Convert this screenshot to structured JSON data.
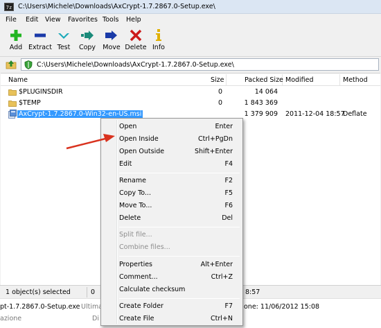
{
  "window": {
    "title": "C:\\Users\\Michele\\Downloads\\AxCrypt-1.7.2867.0-Setup.exe\\",
    "app_icon_text": "7z"
  },
  "menu": [
    "File",
    "Edit",
    "View",
    "Favorites",
    "Tools",
    "Help"
  ],
  "toolbar": [
    {
      "label": "Add",
      "icon": "plus-icon",
      "color": "#22b522"
    },
    {
      "label": "Extract",
      "icon": "minus-icon",
      "color": "#1a3aa8"
    },
    {
      "label": "Test",
      "icon": "checkmark-icon",
      "color": "#1aa9b8"
    },
    {
      "label": "Copy",
      "icon": "copy-arrow-icon",
      "color": "#1a8a7a"
    },
    {
      "label": "Move",
      "icon": "move-arrow-icon",
      "color": "#1a3aa8"
    },
    {
      "label": "Delete",
      "icon": "delete-x-icon",
      "color": "#cc1a1a"
    },
    {
      "label": "Info",
      "icon": "info-icon",
      "color": "#e0b000"
    }
  ],
  "address": {
    "path": "C:\\Users\\Michele\\Downloads\\AxCrypt-1.7.2867.0-Setup.exe\\"
  },
  "columns": [
    "Name",
    "Size",
    "Packed Size",
    "Modified",
    "Method"
  ],
  "files": [
    {
      "name": "$PLUGINSDIR",
      "size": "0",
      "packed": "14 064",
      "modified": "",
      "method": "",
      "type": "folder",
      "selected": false
    },
    {
      "name": "$TEMP",
      "size": "0",
      "packed": "1 843 369",
      "modified": "",
      "method": "",
      "type": "folder",
      "selected": false
    },
    {
      "name": "AxCrypt-1.7.2867.0-Win32-en-US.msi",
      "size": "",
      "packed": "1 379 909",
      "modified": "2011-12-04 18:57",
      "method": "Deflate",
      "type": "msi",
      "selected": true
    }
  ],
  "status": {
    "selected": "1 object(s) selected",
    "size": "0",
    "time_fragment": "8:57"
  },
  "below": {
    "filename_fragment": "pt-1.7.2867.0-Setup.exe",
    "ultima_fragment": "Ultima",
    "azione_fragment": "azione",
    "di_fragment": "Di",
    "date_fragment": "one: 11/06/2012 15:08"
  },
  "context_menu": {
    "groups": [
      [
        {
          "label": "Open",
          "shortcut": "Enter",
          "enabled": true
        },
        {
          "label": "Open Inside",
          "shortcut": "Ctrl+PgDn",
          "enabled": true
        },
        {
          "label": "Open Outside",
          "shortcut": "Shift+Enter",
          "enabled": true
        },
        {
          "label": "Edit",
          "shortcut": "F4",
          "enabled": true
        }
      ],
      [
        {
          "label": "Rename",
          "shortcut": "F2",
          "enabled": true
        },
        {
          "label": "Copy To...",
          "shortcut": "F5",
          "enabled": true
        },
        {
          "label": "Move To...",
          "shortcut": "F6",
          "enabled": true
        },
        {
          "label": "Delete",
          "shortcut": "Del",
          "enabled": true
        }
      ],
      [
        {
          "label": "Split file...",
          "shortcut": "",
          "enabled": false
        },
        {
          "label": "Combine files...",
          "shortcut": "",
          "enabled": false
        }
      ],
      [
        {
          "label": "Properties",
          "shortcut": "Alt+Enter",
          "enabled": true
        },
        {
          "label": "Comment...",
          "shortcut": "Ctrl+Z",
          "enabled": true
        },
        {
          "label": "Calculate checksum",
          "shortcut": "",
          "enabled": true
        }
      ],
      [
        {
          "label": "Create Folder",
          "shortcut": "F7",
          "enabled": true
        },
        {
          "label": "Create File",
          "shortcut": "Ctrl+N",
          "enabled": true
        }
      ]
    ]
  },
  "colors": {
    "selection": "#3399ff",
    "annotation_arrow": "#d9321e",
    "folder": "#e8c25a"
  }
}
